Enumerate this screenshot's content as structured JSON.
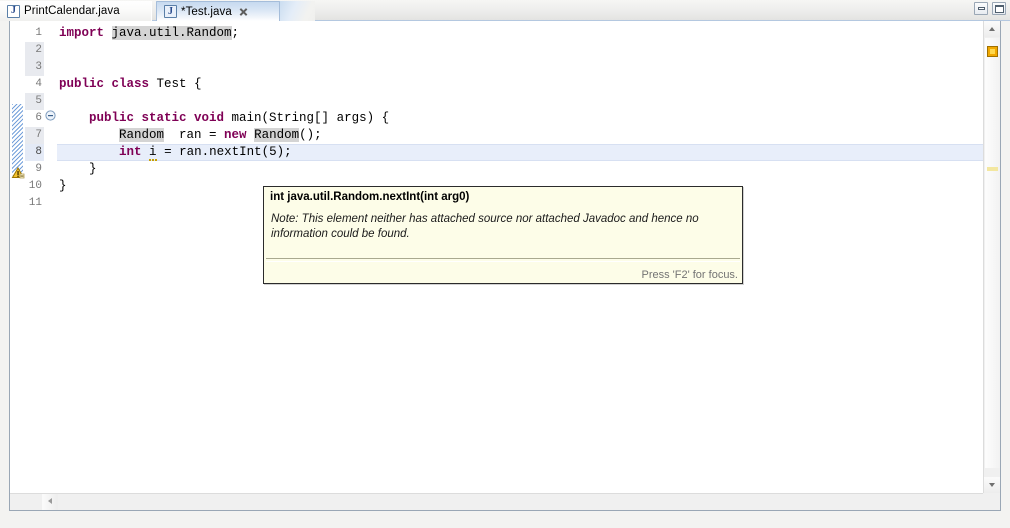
{
  "window": {
    "minimize_label": "Minimize",
    "maximize_label": "Maximize"
  },
  "tabs": [
    {
      "label": "PrintCalendar.java",
      "icon": "java-file-icon",
      "letter": "J",
      "active": false,
      "dirty": false,
      "closable": false
    },
    {
      "label": "*Test.java",
      "icon": "java-file-icon",
      "letter": "J",
      "active": true,
      "dirty": true,
      "closable": true
    }
  ],
  "editor": {
    "line_numbers": [
      "1",
      "2",
      "3",
      "4",
      "5",
      "6",
      "7",
      "8",
      "9",
      "10",
      "11"
    ],
    "current_line": 8,
    "fold_marker_line": 6,
    "warning_marker_line": 8,
    "code_lines": [
      {
        "n": 1,
        "segments": [
          {
            "text": "import ",
            "style": "keyword"
          },
          {
            "text": "java.util.Random",
            "style": "occurrence"
          },
          {
            "text": ";",
            "style": "plain"
          }
        ]
      },
      {
        "n": 2,
        "segments": [
          {
            "text": "",
            "style": "plain"
          }
        ]
      },
      {
        "n": 3,
        "segments": [
          {
            "text": "",
            "style": "plain"
          }
        ]
      },
      {
        "n": 4,
        "segments": [
          {
            "text": "public class ",
            "style": "keyword"
          },
          {
            "text": "Test {",
            "style": "plain"
          }
        ]
      },
      {
        "n": 5,
        "segments": [
          {
            "text": "",
            "style": "plain"
          }
        ]
      },
      {
        "n": 6,
        "segments": [
          {
            "text": "    ",
            "style": "plain"
          },
          {
            "text": "public static void ",
            "style": "keyword"
          },
          {
            "text": "main(String[] args) {",
            "style": "plain"
          }
        ]
      },
      {
        "n": 7,
        "segments": [
          {
            "text": "        ",
            "style": "plain"
          },
          {
            "text": "Random",
            "style": "occurrence"
          },
          {
            "text": "  ran = ",
            "style": "plain"
          },
          {
            "text": "new",
            "style": "keyword"
          },
          {
            "text": " ",
            "style": "plain"
          },
          {
            "text": "Random",
            "style": "occurrence"
          },
          {
            "text": "();",
            "style": "plain"
          }
        ]
      },
      {
        "n": 8,
        "segments": [
          {
            "text": "        ",
            "style": "plain"
          },
          {
            "text": "int",
            "style": "keyword"
          },
          {
            "text": " ",
            "style": "plain"
          },
          {
            "text": "i",
            "style": "warnvar"
          },
          {
            "text": " = ran.nextInt(5);",
            "style": "plain"
          }
        ]
      },
      {
        "n": 9,
        "segments": [
          {
            "text": "    }",
            "style": "plain"
          }
        ]
      },
      {
        "n": 10,
        "segments": [
          {
            "text": "}",
            "style": "plain"
          }
        ]
      },
      {
        "n": 11,
        "segments": [
          {
            "text": "",
            "style": "plain"
          }
        ]
      }
    ]
  },
  "tooltip": {
    "title": "int java.util.Random.nextInt(int arg0)",
    "body": "Note: This element neither has attached source nor attached Javadoc and hence no information could be found.",
    "footer": "Press 'F2' for focus."
  },
  "colors": {
    "keyword": "#7f0055",
    "occurrence_highlight": "#d4d4d4",
    "current_line": "#e8eefa",
    "tooltip_bg": "#fdfde8",
    "warning": "#f0a800",
    "active_tab": "#c6d9ef"
  },
  "icons": {
    "scroll_up": "triangle-up-icon",
    "scroll_down": "triangle-down-icon",
    "scroll_left": "triangle-left-icon",
    "warning": "warning-icon",
    "fold": "fold-collapse-icon",
    "close": "close-icon"
  }
}
